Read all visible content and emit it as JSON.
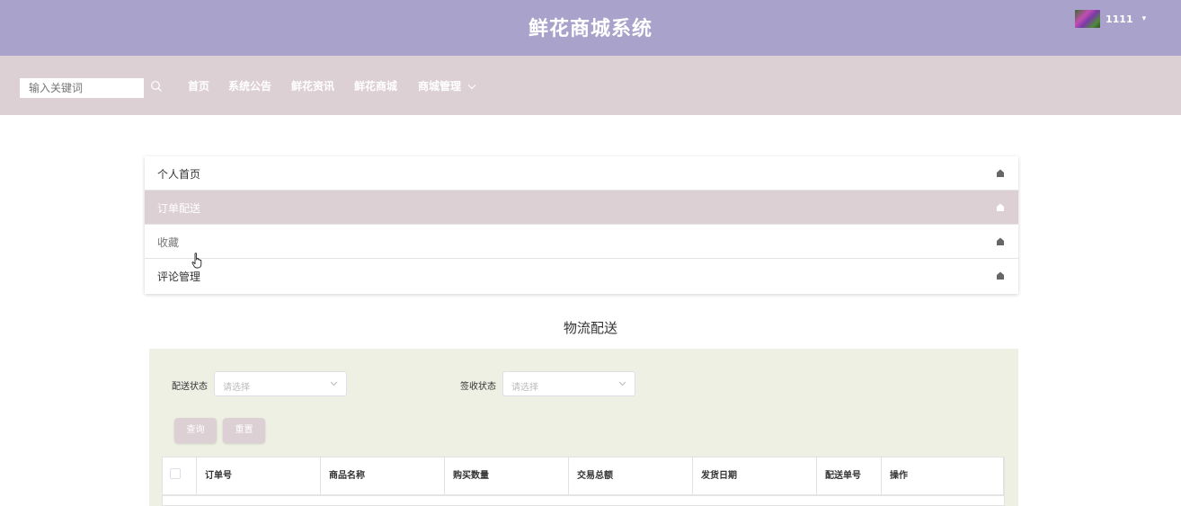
{
  "header": {
    "title": "鲜花商城系统",
    "user": {
      "name": "1111",
      "avatar_icon": "flower-photo-avatar",
      "caret_icon": "caret-down-icon"
    }
  },
  "nav": {
    "search": {
      "placeholder": "输入关键词",
      "icon": "search-icon"
    },
    "items": [
      "首页",
      "系统公告",
      "鲜花资讯",
      "鲜花商城",
      "商城管理"
    ],
    "dropdown_icon": "chevron-down-icon"
  },
  "side_menu": {
    "items": [
      {
        "label": "个人首页",
        "active": false
      },
      {
        "label": "订单配送",
        "active": true
      },
      {
        "label": "收藏",
        "active": false
      },
      {
        "label": "评论管理",
        "active": false
      }
    ],
    "item_icon": "home-icon"
  },
  "section": {
    "title": "物流配送"
  },
  "filters": {
    "delivery_status": {
      "label": "配送状态",
      "placeholder": "请选择"
    },
    "sign_status": {
      "label": "签收状态",
      "placeholder": "请选择"
    },
    "query_button": "查询",
    "reset_button": "重置"
  },
  "table": {
    "columns": [
      "订单号",
      "商品名称",
      "购买数量",
      "交易总额",
      "发货日期",
      "配送单号",
      "操作"
    ]
  },
  "colors": {
    "header_bg": "#a9a3cb",
    "nav_bg": "#ddd0d4",
    "active_row_bg": "#ddd0d4",
    "panel_bg": "#eef0e4"
  }
}
